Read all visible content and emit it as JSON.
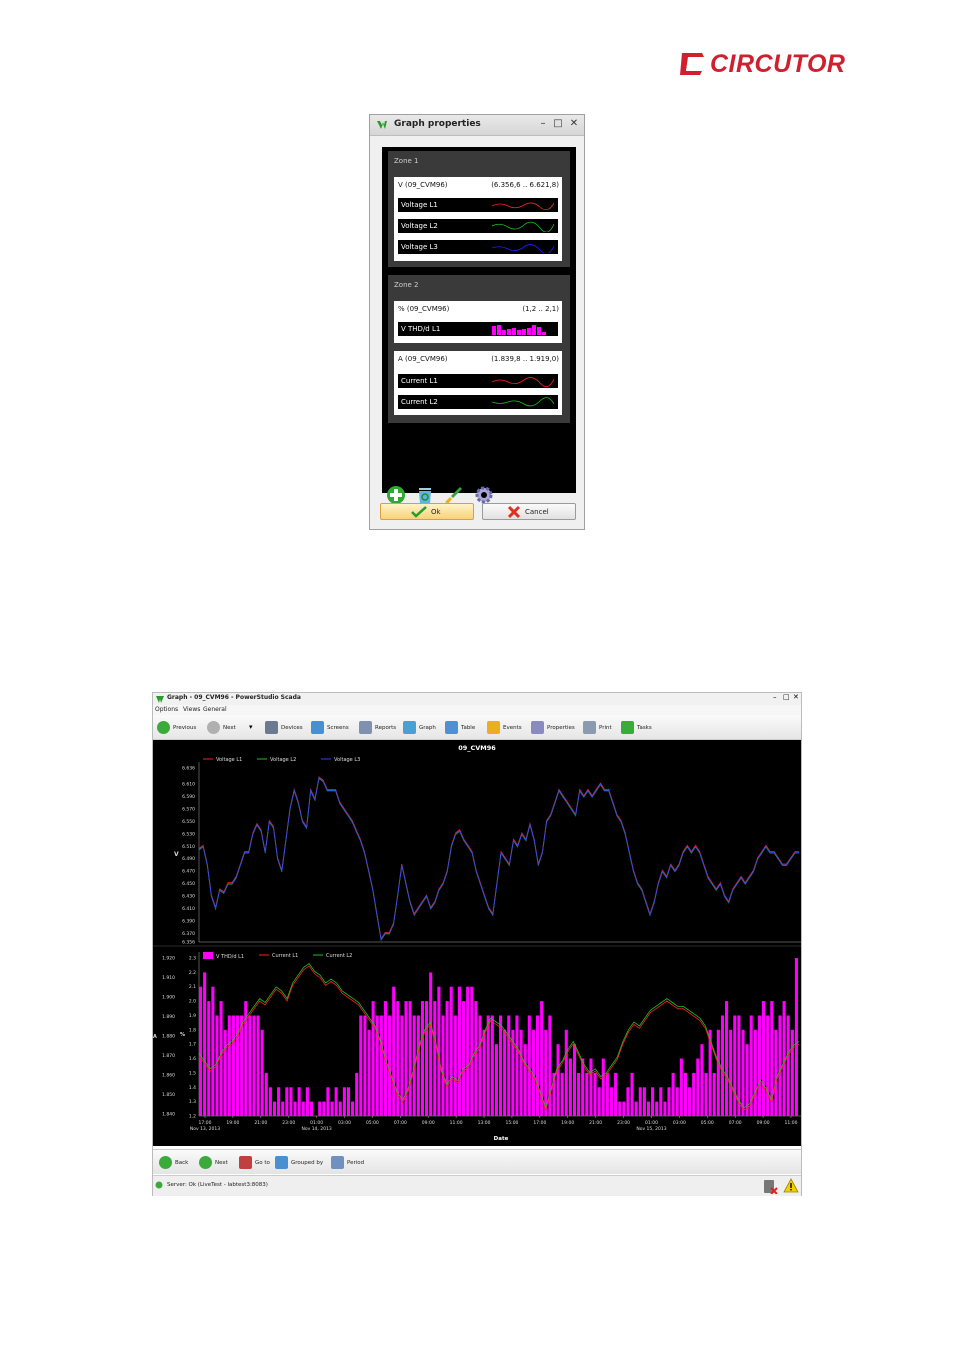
{
  "logo": {
    "text": "CIRCUTOR",
    "color": "#d0202f"
  },
  "dialog": {
    "title": "Graph properties",
    "zones": [
      {
        "label": "Zone 1",
        "cards": [
          {
            "header": "V (09_CVM96)",
            "range": "(6.356,6 .. 6.621,8)",
            "series": [
              {
                "name": "Voltage L1",
                "color": "#ff2020",
                "icon": "line-sparkline-icon"
              },
              {
                "name": "Voltage L2",
                "color": "#20c020",
                "icon": "line-sparkline-icon"
              },
              {
                "name": "Voltage L3",
                "color": "#2020ff",
                "icon": "line-sparkline-icon"
              }
            ]
          }
        ]
      },
      {
        "label": "Zone 2",
        "cards": [
          {
            "header": "% (09_CVM96)",
            "range": "(1,2 .. 2,1)",
            "series": [
              {
                "name": "V THD/d L1",
                "color": "#ff00ff",
                "icon": "bar-sparkline-icon"
              }
            ]
          },
          {
            "header": "A (09_CVM96)",
            "range": "(1.839,8 .. 1.919,0)",
            "series": [
              {
                "name": "Current L1",
                "color": "#ff2020",
                "icon": "line-sparkline-icon"
              },
              {
                "name": "Current L2",
                "color": "#20c020",
                "icon": "line-sparkline-icon"
              }
            ]
          }
        ]
      }
    ],
    "tools": [
      "add-icon",
      "recycle-bin-icon",
      "brush-icon",
      "gear-icon"
    ],
    "ok_label": "Ok",
    "cancel_label": "Cancel"
  },
  "window": {
    "title": "Graph - 09_CVM96 - PowerStudio Scada",
    "menu": [
      "Options",
      "Views",
      "General"
    ],
    "toolbar": [
      {
        "label": "Previous",
        "icon": "back-arrow-icon"
      },
      {
        "label": "Next",
        "icon": "forward-arrow-icon"
      },
      {
        "label": "Devices",
        "icon": "device-icon"
      },
      {
        "label": "Screens",
        "icon": "screen-icon"
      },
      {
        "label": "Reports",
        "icon": "report-icon"
      },
      {
        "label": "Graph",
        "icon": "graph-icon"
      },
      {
        "label": "Table",
        "icon": "table-icon"
      },
      {
        "label": "Events",
        "icon": "events-icon"
      },
      {
        "label": "Properties",
        "icon": "gear-icon"
      },
      {
        "label": "Print",
        "icon": "printer-icon"
      },
      {
        "label": "Tasks",
        "icon": "tasks-icon"
      }
    ],
    "bottom_toolbar": [
      {
        "label": "Back",
        "icon": "back-arrow-icon"
      },
      {
        "label": "Next",
        "icon": "forward-arrow-icon"
      },
      {
        "label": "Go to",
        "icon": "calendar-icon"
      },
      {
        "label": "Grouped by",
        "icon": "group-icon"
      },
      {
        "label": "Period",
        "icon": "clock-icon"
      }
    ],
    "status_text": "Server: Ok (LiveTest - labtest3:8083)",
    "status_icons": [
      "disconnected-device-icon",
      "warning-icon"
    ]
  },
  "chart_data": [
    {
      "type": "line",
      "title": "09_CVM96",
      "ylabel": "V",
      "ylim": [
        6.356,
        6.636
      ],
      "yticks": [
        "6.356",
        "6.370",
        "6.390",
        "6.410",
        "6.430",
        "6.450",
        "6.470",
        "6.490",
        "6.510",
        "6.530",
        "6.550",
        "6.570",
        "6.590",
        "6.610",
        "6.636"
      ],
      "series": [
        {
          "name": "Voltage L1",
          "color": "#ff2020"
        },
        {
          "name": "Voltage L2",
          "color": "#20c020"
        },
        {
          "name": "Voltage L3",
          "color": "#3040ff"
        }
      ],
      "x": [
        0,
        1,
        2,
        3,
        4,
        5,
        6,
        7,
        8,
        9,
        10,
        11,
        12,
        13,
        14,
        15,
        16,
        17,
        18,
        19,
        20,
        21,
        22,
        23,
        24,
        25,
        26,
        27,
        28,
        29,
        30,
        31,
        32,
        33,
        34,
        35,
        36,
        37,
        38,
        39,
        40,
        41,
        42,
        43,
        44,
        45,
        46,
        47,
        48,
        49,
        50,
        51,
        52,
        53,
        54,
        55,
        56,
        57,
        58,
        59,
        60,
        61,
        62,
        63,
        64,
        65,
        66,
        67,
        68,
        69,
        70,
        71,
        72,
        73,
        74,
        75,
        76,
        77,
        78,
        79,
        80,
        81,
        82,
        83,
        84,
        85,
        86,
        87,
        88,
        89,
        90,
        91,
        92,
        93,
        94,
        95,
        96,
        97,
        98,
        99,
        100,
        101,
        102,
        103,
        104,
        105,
        106,
        107,
        108,
        109,
        110,
        111,
        112,
        113,
        114,
        115,
        116,
        117,
        118,
        119,
        120,
        121,
        122,
        123,
        124,
        125,
        126,
        127,
        128,
        129,
        130,
        131,
        132,
        133,
        134,
        135,
        136,
        137,
        138,
        139,
        140,
        141,
        142,
        143,
        144,
        145
      ],
      "values": [
        6.505,
        6.51,
        6.48,
        6.43,
        6.41,
        6.44,
        6.435,
        6.45,
        6.45,
        6.46,
        6.48,
        6.5,
        6.5,
        6.53,
        6.545,
        6.535,
        6.5,
        6.55,
        6.54,
        6.49,
        6.47,
        6.52,
        6.57,
        6.6,
        6.58,
        6.55,
        6.54,
        6.6,
        6.585,
        6.62,
        6.615,
        6.6,
        6.6,
        6.6,
        6.58,
        6.57,
        6.56,
        6.55,
        6.535,
        6.52,
        6.5,
        6.47,
        6.44,
        6.4,
        6.36,
        6.37,
        6.37,
        6.385,
        6.43,
        6.48,
        6.45,
        6.42,
        6.4,
        6.41,
        6.42,
        6.43,
        6.41,
        6.42,
        6.44,
        6.45,
        6.47,
        6.51,
        6.53,
        6.535,
        6.52,
        6.51,
        6.5,
        6.47,
        6.45,
        6.43,
        6.41,
        6.4,
        6.45,
        6.5,
        6.49,
        6.48,
        6.52,
        6.51,
        6.53,
        6.52,
        6.545,
        6.52,
        6.48,
        6.5,
        6.55,
        6.56,
        6.58,
        6.6,
        6.59,
        6.58,
        6.57,
        6.56,
        6.6,
        6.59,
        6.6,
        6.59,
        6.6,
        6.61,
        6.6,
        6.6,
        6.58,
        6.56,
        6.55,
        6.53,
        6.5,
        6.47,
        6.45,
        6.44,
        6.42,
        6.4,
        6.42,
        6.45,
        6.47,
        6.46,
        6.48,
        6.47,
        6.48,
        6.5,
        6.51,
        6.5,
        6.51,
        6.5,
        6.48,
        6.46,
        6.45,
        6.44,
        6.45,
        6.43,
        6.42,
        6.44,
        6.45,
        6.46,
        6.45,
        6.46,
        6.47,
        6.49,
        6.5,
        6.51,
        6.5,
        6.5,
        6.49,
        6.48,
        6.48,
        6.49,
        6.5,
        6.5
      ]
    },
    {
      "type": "bar",
      "ylabel_left": "A",
      "ylabel_right": "%",
      "ylim_left": [
        1.839,
        1.919
      ],
      "ylim_right": [
        1.2,
        2.3
      ],
      "yticks_left": [
        "1.840",
        "1.850",
        "1.860",
        "1.870",
        "1.880",
        "1.890",
        "1.900",
        "1.910",
        "1.920"
      ],
      "yticks_right": [
        "1.2",
        "1.3",
        "1.4",
        "1.5",
        "1.6",
        "1.7",
        "1.8",
        "1.9",
        "2.0",
        "2.1",
        "2.2",
        "2.3"
      ],
      "series": [
        {
          "name": "V THD/d L1",
          "color": "#ff00ff",
          "kind": "bar"
        },
        {
          "name": "Current L1",
          "color": "#ff2020",
          "kind": "line"
        },
        {
          "name": "Current L2",
          "color": "#20c020",
          "kind": "line"
        }
      ],
      "xlabel": "Date",
      "xticks": [
        "17:00",
        "19:00",
        "21:00",
        "23:00",
        "01:00",
        "03:00",
        "05:00",
        "07:00",
        "09:00",
        "11:00",
        "13:00",
        "15:00",
        "17:00",
        "19:00",
        "21:00",
        "23:00",
        "01:00",
        "03:00",
        "05:00",
        "07:00",
        "09:00",
        "11:00"
      ],
      "date_labels": [
        {
          "text": "Nov 13, 2013",
          "at": 0
        },
        {
          "text": "Nov 14, 2013",
          "at": 4
        },
        {
          "text": "Nov 15, 2013",
          "at": 16
        }
      ],
      "thd_values": [
        2.1,
        2.2,
        2.0,
        2.1,
        1.9,
        2.0,
        1.8,
        1.9,
        1.9,
        1.9,
        1.9,
        2.0,
        1.9,
        1.9,
        1.9,
        1.8,
        1.5,
        1.4,
        1.3,
        1.4,
        1.3,
        1.4,
        1.4,
        1.3,
        1.4,
        1.3,
        1.4,
        1.3,
        1.2,
        1.3,
        1.3,
        1.4,
        1.3,
        1.4,
        1.3,
        1.4,
        1.4,
        1.3,
        1.5,
        1.9,
        1.9,
        1.8,
        2.0,
        1.9,
        1.9,
        2.0,
        1.9,
        2.1,
        2.0,
        1.9,
        2.0,
        2.0,
        1.9,
        1.9,
        2.0,
        2.0,
        2.2,
        2.0,
        2.1,
        1.9,
        2.0,
        2.1,
        1.9,
        2.1,
        2.0,
        2.1,
        2.1,
        2.0,
        1.9,
        1.8,
        1.9,
        1.9,
        1.7,
        1.9,
        1.8,
        1.9,
        1.8,
        1.9,
        1.8,
        1.7,
        1.9,
        1.8,
        1.9,
        2.0,
        1.8,
        1.9,
        1.5,
        1.7,
        1.5,
        1.8,
        1.6,
        1.7,
        1.5,
        1.6,
        1.5,
        1.6,
        1.5,
        1.4,
        1.6,
        1.5,
        1.4,
        1.5,
        1.3,
        1.3,
        1.4,
        1.5,
        1.3,
        1.4,
        1.4,
        1.3,
        1.4,
        1.3,
        1.4,
        1.3,
        1.4,
        1.5,
        1.4,
        1.6,
        1.5,
        1.4,
        1.5,
        1.6,
        1.7,
        1.5,
        1.8,
        1.5,
        1.8,
        1.9,
        2.0,
        1.8,
        1.9,
        1.9,
        1.8,
        1.7,
        1.9,
        1.8,
        1.9,
        2.0,
        1.9,
        2.0,
        1.8,
        1.9,
        2.0,
        1.9,
        1.8,
        2.3
      ],
      "current_values": [
        1.87,
        1.866,
        1.862,
        1.864,
        1.87,
        1.874,
        1.876,
        1.88,
        1.886,
        1.89,
        1.894,
        1.898,
        1.896,
        1.9,
        1.904,
        1.902,
        1.898,
        1.906,
        1.91,
        1.914,
        1.916,
        1.912,
        1.91,
        1.906,
        1.908,
        1.906,
        1.902,
        1.9,
        1.898,
        1.896,
        1.892,
        1.888,
        1.884,
        1.876,
        1.866,
        1.858,
        1.85,
        1.846,
        1.852,
        1.862,
        1.874,
        1.882,
        1.886,
        1.876,
        1.862,
        1.854,
        1.858,
        1.856,
        1.862,
        1.864,
        1.87,
        1.874,
        1.882,
        1.888,
        1.886,
        1.884,
        1.88,
        1.876,
        1.872,
        1.866,
        1.862,
        1.858,
        1.85,
        1.842,
        1.852,
        1.862,
        1.866,
        1.872,
        1.876,
        1.87,
        1.864,
        1.86,
        1.862,
        1.858,
        1.86,
        1.864,
        1.868,
        1.876,
        1.882,
        1.886,
        1.884,
        1.888,
        1.892,
        1.894,
        1.896,
        1.898,
        1.896,
        1.894,
        1.894,
        1.892,
        1.89,
        1.888,
        1.884,
        1.876,
        1.868,
        1.862,
        1.858,
        1.852,
        1.846,
        1.842,
        1.844,
        1.85,
        1.856,
        1.852,
        1.846,
        1.858,
        1.864,
        1.87,
        1.874,
        1.876
      ]
    }
  ]
}
